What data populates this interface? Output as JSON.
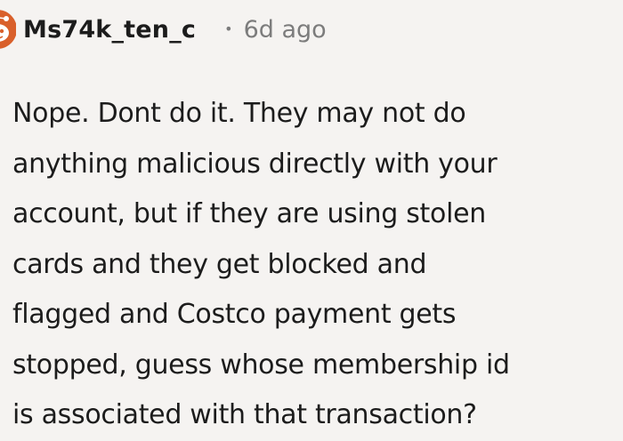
{
  "comment": {
    "username": "Ms74k_ten_c",
    "separator": "•",
    "timestamp": "6d ago",
    "avatar_icon": "snoo-avatar-icon",
    "body_lines": [
      "Nope. Dont do it. They may not do",
      "anything malicious directly with your",
      "account, but if they are using stolen",
      "cards and they get blocked and",
      "flagged and Costco payment gets",
      "stopped, guess whose membership id",
      "is associated with that transaction?"
    ]
  },
  "colors": {
    "background": "#f5f3f1",
    "text": "#1c1c1c",
    "meta": "#7c7c7c",
    "avatar_orange": "#d9602b"
  }
}
